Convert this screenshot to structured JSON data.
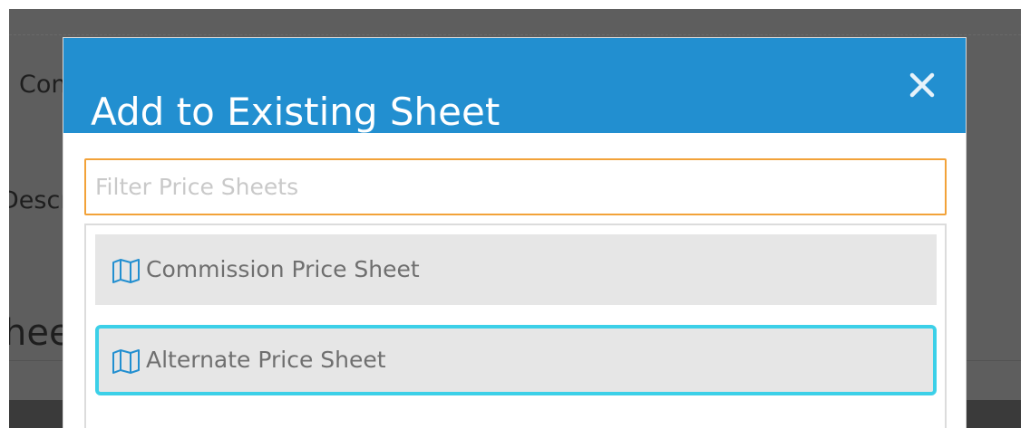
{
  "background": {
    "partial_texts": [
      "Con",
      "Descr",
      "hee"
    ]
  },
  "modal": {
    "title": "Add to Existing Sheet",
    "close_icon": "close-icon"
  },
  "filter": {
    "placeholder": "Filter Price Sheets",
    "value": ""
  },
  "price_sheets": [
    {
      "label": "Commission Price Sheet",
      "icon": "map-icon",
      "selected": false
    },
    {
      "label": "Alternate Price Sheet",
      "icon": "map-icon",
      "selected": true
    }
  ],
  "colors": {
    "header": "#228fd0",
    "input_focus_border": "#f2a239",
    "selected_outline": "#3cd0e8",
    "item_background": "#e6e6e6",
    "icon": "#228fd0"
  }
}
